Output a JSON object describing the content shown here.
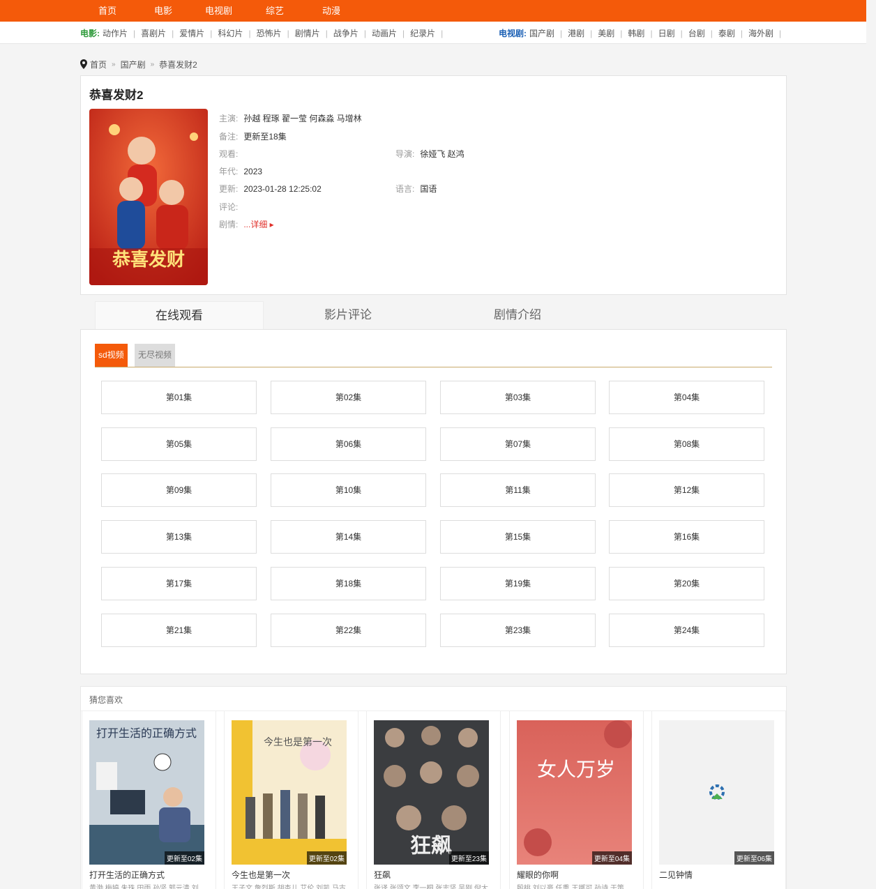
{
  "topnav": {
    "items": [
      "首页",
      "电影",
      "电视剧",
      "综艺",
      "动漫"
    ]
  },
  "subnav": {
    "movie_label": "电影:",
    "movie_items": [
      "动作片",
      "喜剧片",
      "爱情片",
      "科幻片",
      "恐怖片",
      "剧情片",
      "战争片",
      "动画片",
      "纪录片"
    ],
    "tv_label": "电视剧:",
    "tv_items": [
      "国产剧",
      "港剧",
      "美剧",
      "韩剧",
      "日剧",
      "台剧",
      "泰剧",
      "海外剧"
    ],
    "separator": "|",
    "movie_label_color": "#2e9a3a",
    "tv_label_color": "#1a5fb4"
  },
  "breadcrumb": {
    "items": [
      "首页",
      "国产剧",
      "恭喜发财2"
    ],
    "separator": "»"
  },
  "detail": {
    "title": "恭喜发财2",
    "poster_text": "恭喜发财",
    "fields": {
      "cast_label": "主演:",
      "cast": "孙越 程琢 翟一莹 何森淼 马增林",
      "note_label": "备注:",
      "note": "更新至18集",
      "views_label": "观看:",
      "views": "",
      "director_label": "导演:",
      "director": "徐娅飞 赵鸿",
      "year_label": "年代:",
      "year": "2023",
      "updated_label": "更新:",
      "updated": "2023-01-28 12:25:02",
      "language_label": "语言:",
      "language": "国语",
      "comments_label": "评论:",
      "comments": "",
      "plot_label": "剧情:",
      "plot_more": "...详细 ▸"
    }
  },
  "tabs": [
    "在线观看",
    "影片评论",
    "剧情介绍"
  ],
  "sources": [
    "sd视频",
    "无尽视频"
  ],
  "episodes": [
    "第01集",
    "第02集",
    "第03集",
    "第04集",
    "第05集",
    "第06集",
    "第07集",
    "第08集",
    "第09集",
    "第10集",
    "第11集",
    "第12集",
    "第13集",
    "第14集",
    "第15集",
    "第16集",
    "第17集",
    "第18集",
    "第19集",
    "第20集",
    "第21集",
    "第22集",
    "第23集",
    "第24集"
  ],
  "recommend": {
    "heading": "猜您喜欢",
    "items": [
      {
        "name": "打开生活的正确方式",
        "badge": "更新至02集",
        "cast": "黄渤,梅婷,朱珠,田雨,孙坚,郭元清,刘",
        "poster_text": "打开生活的正确方式"
      },
      {
        "name": "今生也是第一次",
        "badge": "更新至02集",
        "cast": "王子文,詹烈斯,胡杏儿,艾伦,刘凯,马古",
        "poster_text": "今生也是第一次"
      },
      {
        "name": "狂飙",
        "badge": "更新至23集",
        "cast": "张译,张颂文,李一桐,张志坚,吴刚,倪大",
        "poster_text": "狂飙"
      },
      {
        "name": "耀眼的你啊",
        "badge": "更新至04集",
        "cast": "殷桃,刘以豪,任重,王娜可,孙诗,于策",
        "poster_text": "女人万岁"
      },
      {
        "name": "二见钟情",
        "badge": "更新至06集",
        "cast": "",
        "poster_text": ""
      }
    ]
  }
}
